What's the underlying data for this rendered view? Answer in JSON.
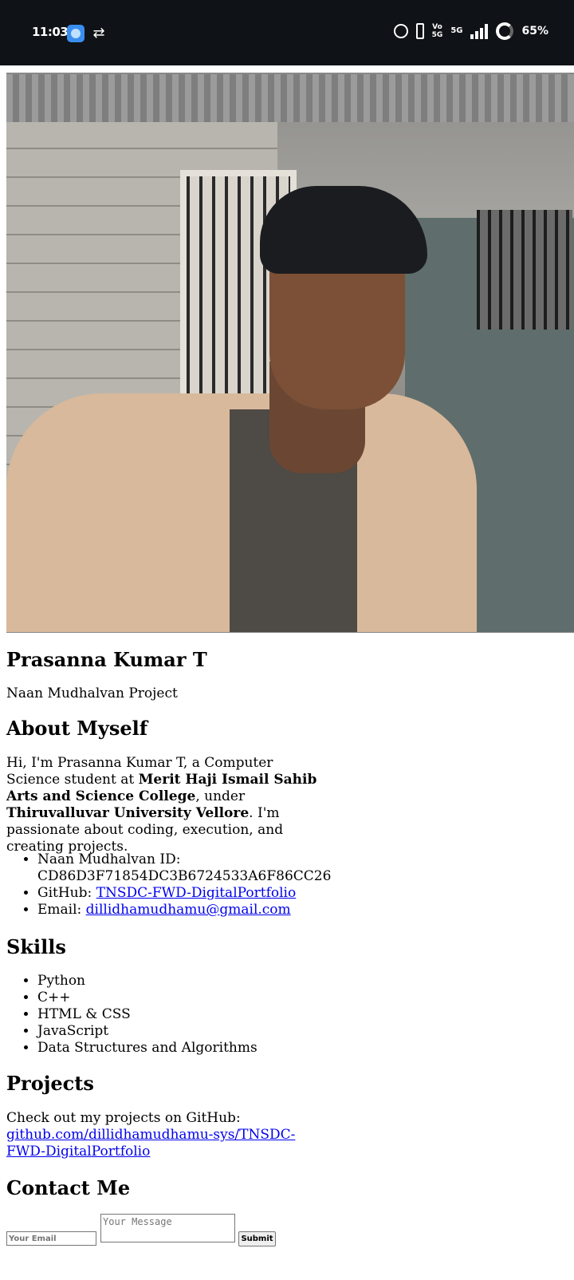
{
  "status_bar": {
    "time": "11:03",
    "volte": "Vo\n5G",
    "network": "5G",
    "battery": "65%"
  },
  "profile": {
    "name": "Prasanna Kumar T",
    "tagline": "Naan Mudhalvan Project"
  },
  "about": {
    "heading": "About Myself",
    "text_1": "Hi, I'm Prasanna Kumar T, a Computer Science student at ",
    "college": "Merit Haji Ismail Sahib Arts and Science College",
    "text_2": ", under ",
    "university": "Thiruvalluvar University Vellore",
    "text_3": ". I'm passionate about coding, execution, and creating projects.",
    "items": [
      {
        "label": "Naan Mudhalvan ID: ",
        "value": "CD86D3F71854DC3B6724533A6F86CC26"
      },
      {
        "label": "GitHub: ",
        "link": "TNSDC-FWD-DigitalPortfolio"
      },
      {
        "label": "Email: ",
        "link": "dillidhamudhamu@gmail.com"
      }
    ]
  },
  "skills": {
    "heading": "Skills",
    "items": [
      "Python",
      "C++",
      "HTML & CSS",
      "JavaScript",
      "Data Structures and Algorithms"
    ]
  },
  "projects": {
    "heading": "Projects",
    "text": "Check out my projects on GitHub: ",
    "link": "github.com/dillidhamudhamu-sys/TNSDC-FWD-DigitalPortfolio"
  },
  "contact": {
    "heading": "Contact Me",
    "email_placeholder": "Your Email",
    "message_placeholder": "Your Message",
    "submit_label": "Submit"
  }
}
